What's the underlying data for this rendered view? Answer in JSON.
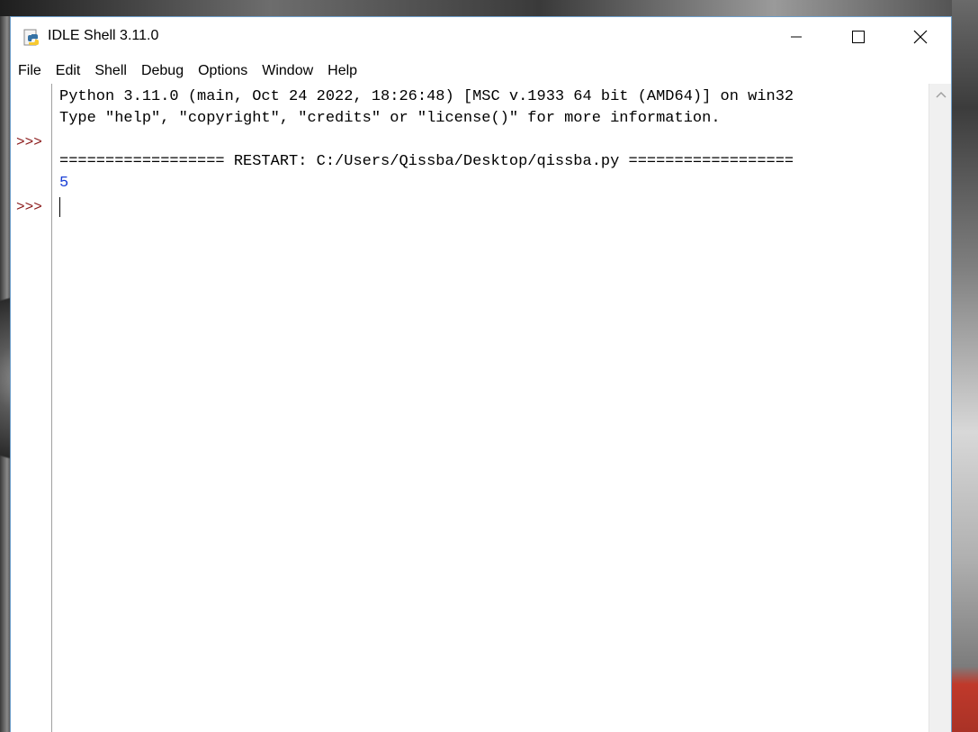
{
  "window": {
    "title": "IDLE Shell 3.11.0",
    "icon": "python-idle-icon"
  },
  "titlebar_buttons": {
    "minimize": "minimize-icon",
    "maximize": "maximize-icon",
    "close": "close-icon"
  },
  "menu": [
    "File",
    "Edit",
    "Shell",
    "Debug",
    "Options",
    "Window",
    "Help"
  ],
  "shell": {
    "banner_line1": "Python 3.11.0 (main, Oct 24 2022, 18:26:48) [MSC v.1933 64 bit (AMD64)] on win32",
    "banner_line2": "Type \"help\", \"copyright\", \"credits\" or \"license()\" for more information.",
    "restart_line": "================== RESTART: C:/Users/Qissba/Desktop/qissba.py ==================",
    "output": "5",
    "prompt": ">>>"
  },
  "colors": {
    "prompt": "#8b1a1a",
    "output": "#1a3fd6",
    "window_border": "#6e9ec9"
  }
}
